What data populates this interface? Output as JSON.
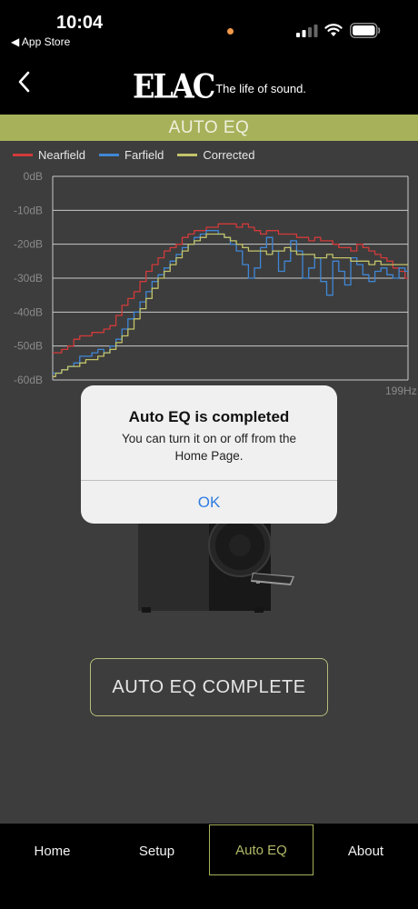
{
  "status_bar": {
    "time": "10:04",
    "back_app": "◀ App Store"
  },
  "header": {
    "logo_mark": "ELAC",
    "logo_tagline": "The life of sound."
  },
  "title": "AUTO EQ",
  "legend": [
    {
      "name": "Nearfield",
      "color": "#d33a3a"
    },
    {
      "name": "Farfield",
      "color": "#3f87d6"
    },
    {
      "name": "Corrected",
      "color": "#c2c36a"
    }
  ],
  "chart_data": {
    "type": "line",
    "ylabel": "",
    "xlabel": "",
    "ylim": [
      -60,
      0
    ],
    "yticks": [
      "0dB",
      "-10dB",
      "-20dB",
      "-30dB",
      "-40dB",
      "-50dB",
      "-60dB"
    ],
    "x_tick_end": "199Hz",
    "grid": true,
    "series": [
      {
        "name": "Nearfield",
        "color": "#d33a3a",
        "values": [
          -52,
          -52,
          -51,
          -50,
          -48,
          -47,
          -47,
          -46,
          -46,
          -45,
          -44,
          -41,
          -38,
          -36,
          -34,
          -31,
          -28,
          -26,
          -24,
          -22,
          -21,
          -20,
          -18,
          -17,
          -16,
          -16,
          -15,
          -15,
          -14,
          -14,
          -14,
          -15,
          -14,
          -15,
          -16,
          -17,
          -16,
          -16,
          -17,
          -17,
          -17,
          -18,
          -18,
          -19,
          -18,
          -19,
          -19,
          -20,
          -21,
          -21,
          -22,
          -20,
          -21,
          -22,
          -23,
          -24,
          -25,
          -27,
          -28,
          -30
        ]
      },
      {
        "name": "Farfield",
        "color": "#3f87d6",
        "values": [
          -58,
          -58,
          -57,
          -56,
          -55,
          -53,
          -53,
          -52,
          -51,
          -52,
          -50,
          -48,
          -45,
          -42,
          -40,
          -37,
          -34,
          -31,
          -29,
          -27,
          -25,
          -23,
          -21,
          -20,
          -18,
          -17,
          -16,
          -16,
          -17,
          -18,
          -20,
          -22,
          -26,
          -30,
          -27,
          -21,
          -18,
          -22,
          -28,
          -25,
          -19,
          -22,
          -30,
          -27,
          -24,
          -31,
          -35,
          -25,
          -28,
          -32,
          -24,
          -26,
          -29,
          -31,
          -28,
          -27,
          -29,
          -30,
          -27,
          -28
        ]
      },
      {
        "name": "Corrected",
        "color": "#c2c36a",
        "values": [
          -59,
          -58,
          -57,
          -56,
          -56,
          -55,
          -54,
          -54,
          -53,
          -52,
          -51,
          -49,
          -47,
          -45,
          -42,
          -39,
          -36,
          -33,
          -30,
          -28,
          -26,
          -24,
          -22,
          -20,
          -19,
          -18,
          -17,
          -17,
          -17,
          -18,
          -19,
          -20,
          -21,
          -22,
          -22,
          -22,
          -23,
          -22,
          -22,
          -21,
          -22,
          -23,
          -23,
          -23,
          -24,
          -24,
          -23,
          -24,
          -24,
          -24,
          -25,
          -25,
          -25,
          -26,
          -25,
          -26,
          -26,
          -26,
          -26,
          -26
        ]
      }
    ]
  },
  "dialog": {
    "title": "Auto EQ is completed",
    "message": "You can turn it on or off from the Home Page.",
    "ok_label": "OK"
  },
  "complete_button_label": "AUTO EQ COMPLETE",
  "tabs": [
    {
      "label": "Home",
      "active": false
    },
    {
      "label": "Setup",
      "active": false
    },
    {
      "label": "Auto EQ",
      "active": true
    },
    {
      "label": "About",
      "active": false
    }
  ]
}
